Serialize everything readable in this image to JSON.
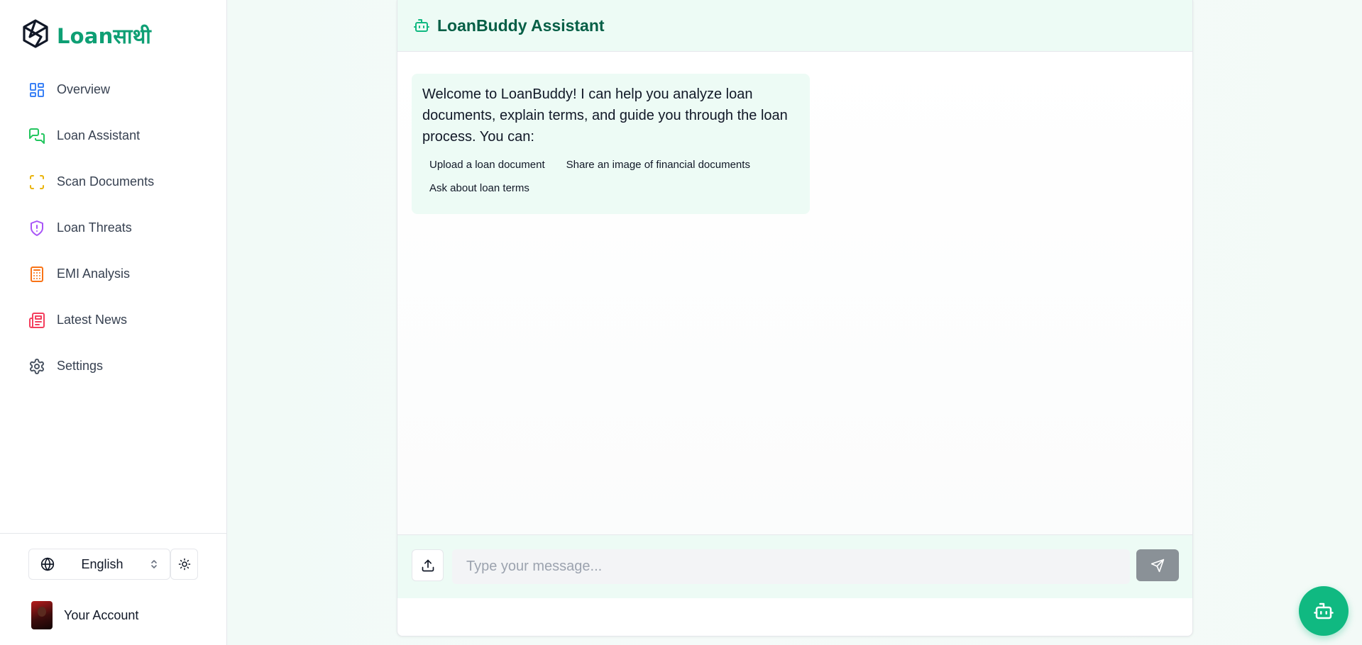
{
  "brand": {
    "name": "Loanसाथी"
  },
  "sidebar": {
    "items": [
      {
        "label": "Overview",
        "icon": "dashboard-icon",
        "color": "#3b82f6"
      },
      {
        "label": "Loan Assistant",
        "icon": "chat-bubbles-icon",
        "color": "#22c55e"
      },
      {
        "label": "Scan Documents",
        "icon": "scan-icon",
        "color": "#eab308"
      },
      {
        "label": "Loan Threats",
        "icon": "shield-alert-icon",
        "color": "#a855f7"
      },
      {
        "label": "EMI Analysis",
        "icon": "calculator-icon",
        "color": "#f97316"
      },
      {
        "label": "Latest News",
        "icon": "newspaper-icon",
        "color": "#f43f5e"
      },
      {
        "label": "Settings",
        "icon": "gear-icon",
        "color": "#4b5563"
      }
    ],
    "language": {
      "selected": "English"
    },
    "account": {
      "label": "Your Account"
    }
  },
  "chat": {
    "title": "LoanBuddy Assistant",
    "welcome": "Welcome to LoanBuddy! I can help you analyze loan documents, explain terms, and guide you through the loan process. You can:",
    "suggestions": [
      "Upload a loan document",
      "Share an image of financial documents",
      "Ask about loan terms"
    ],
    "input": {
      "placeholder": "Type your message..."
    }
  },
  "colors": {
    "accent": "#10b981",
    "brand_text": "#0e9f74",
    "header_bg": "#edfbf5",
    "send_button": "#8a9197"
  }
}
